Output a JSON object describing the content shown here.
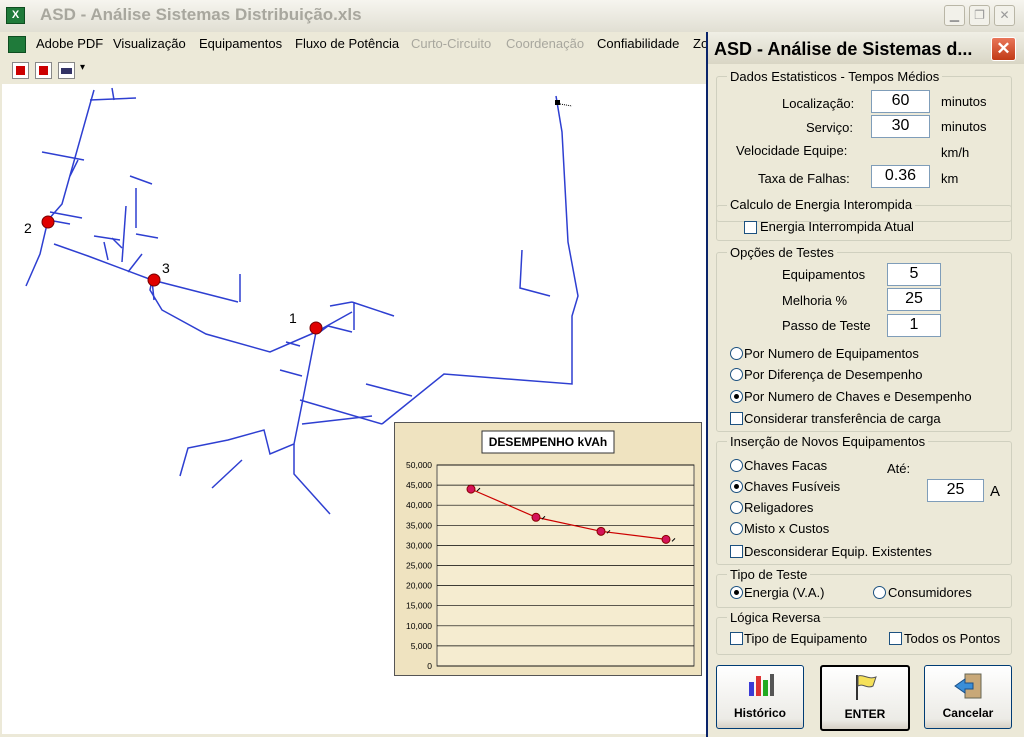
{
  "window": {
    "title": "ASD - Análise Sistemas Distribuição.xls",
    "app_icon": "excel-icon"
  },
  "menu": [
    "Adobe PDF",
    "Visualização",
    "Equipamentos",
    "Fluxo de Potência",
    "Curto-Circuito",
    "Coordenação",
    "Confiabilidade",
    "Zo"
  ],
  "toolbar_icons": [
    "pdf-convert-icon",
    "pdf-review-icon",
    "pdf-email-icon"
  ],
  "map": {
    "markers": [
      {
        "label": "2"
      },
      {
        "label": "3"
      },
      {
        "label": "1"
      }
    ]
  },
  "chart_data": {
    "type": "line",
    "title": "DESEMPENHO kVAh",
    "xlabel": "",
    "ylabel": "",
    "ylim": [
      0,
      50000
    ],
    "yticks": [
      "50,000",
      "45,000",
      "40,000",
      "35,000",
      "30,000",
      "25,000",
      "20,000",
      "15,000",
      "10,000",
      "5,000",
      "0"
    ],
    "x": [
      1,
      2,
      3,
      4
    ],
    "series": [
      {
        "values": [
          44000,
          37000,
          33500,
          31500
        ]
      }
    ],
    "grid": true,
    "colors": {
      "line": "#cc0000",
      "marker": "#d4145a",
      "plot_bg": "#f5ecd0"
    }
  },
  "dialog": {
    "title": "ASD - Análise de Sistemas d...",
    "close_label": "✕",
    "stats": {
      "title": "Dados Estatisticos - Tempos Médios",
      "localizacao_label": "Localização:",
      "localizacao_value": "60",
      "localizacao_unit": "minutos",
      "servico_label": "Serviço:",
      "servico_value": "30",
      "servico_unit": "minutos",
      "velocidade_label": "Velocidade Equipe:",
      "velocidade_unit": "km/h",
      "taxa_label": "Taxa de Falhas:",
      "taxa_value": "0.36",
      "taxa_unit": "km"
    },
    "energia": {
      "title": "Calculo de Energia Interompida",
      "checkbox_label": "Energia Interrompida Atual",
      "checked": false
    },
    "opcoes": {
      "title": "Opções de Testes",
      "equipamentos_label": "Equipamentos",
      "equipamentos_value": "5",
      "melhoria_label": "Melhoria %",
      "melhoria_value": "25",
      "passo_label": "Passo de Teste",
      "passo_value": "1",
      "radios": [
        "Por Numero de Equipamentos",
        "Por Diferença de Desempenho",
        "Por Numero de Chaves e Desempenho"
      ],
      "selected": 2,
      "checkbox_label": "Considerar transferência de carga"
    },
    "insercao": {
      "title": "Inserção de Novos Equipamentos",
      "radios": [
        "Chaves Facas",
        "Chaves Fusíveis",
        "Religadores",
        "Misto x Custos"
      ],
      "selected": 1,
      "ate_label": "Até:",
      "ate_value": "25",
      "ate_unit": "A",
      "checkbox_label": "Desconsiderar Equip. Existentes"
    },
    "tipo": {
      "title": "Tipo de Teste",
      "radios": [
        "Energia (V.A.)",
        "Consumidores"
      ],
      "selected": 0
    },
    "logica": {
      "title": "Lógica Reversa",
      "check1": "Tipo de Equipamento",
      "check2": "Todos os Pontos"
    },
    "buttons": {
      "historico": "Histórico",
      "enter": "ENTER",
      "cancelar": "Cancelar"
    },
    "icons": {
      "historico": "bar-chart-icon",
      "enter": "flag-icon",
      "cancelar": "exit-door-icon"
    }
  }
}
